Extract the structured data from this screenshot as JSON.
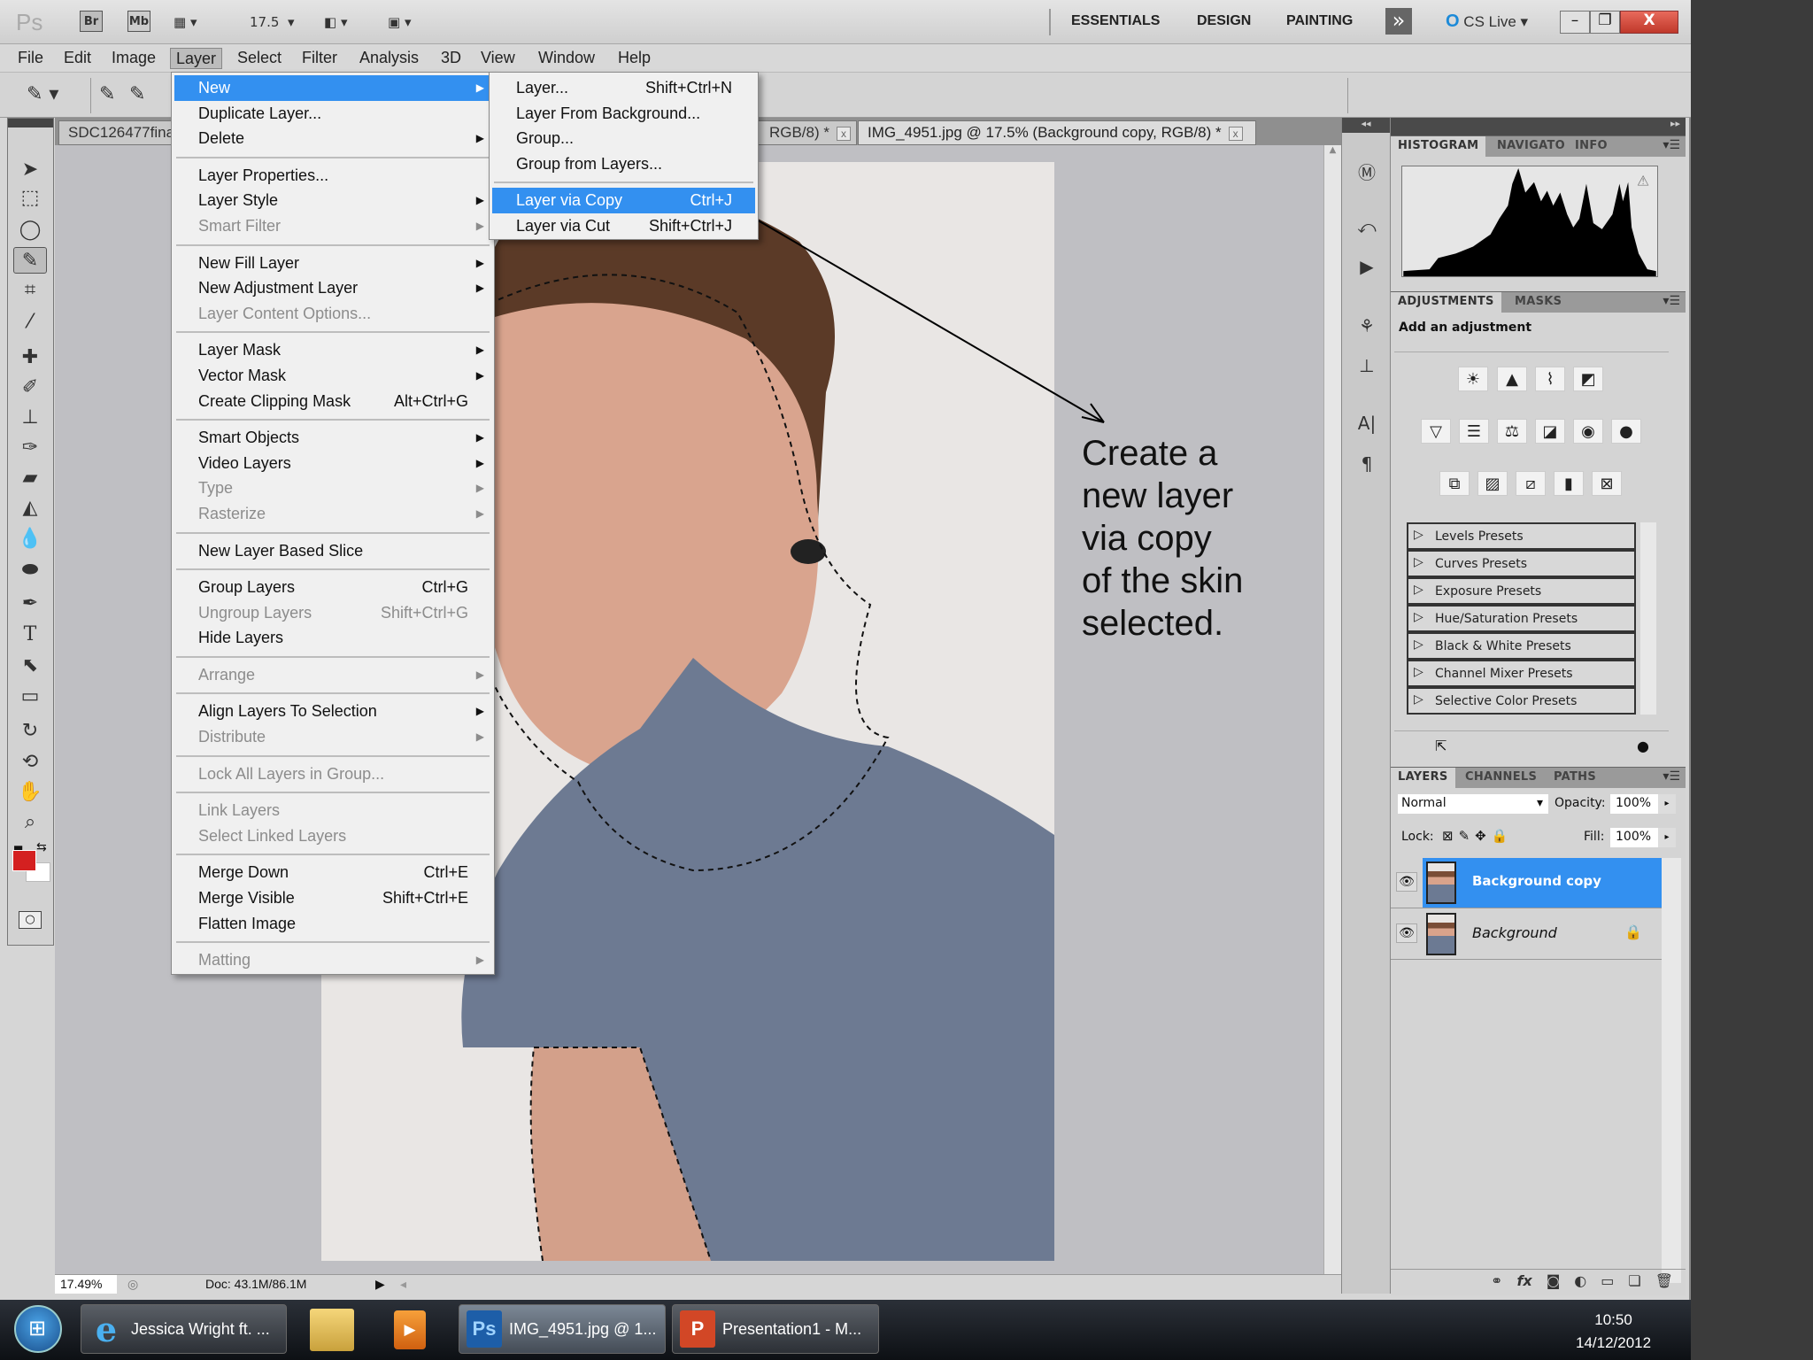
{
  "topbar": {
    "ps_logo": "Ps",
    "bridge": "Br",
    "mini_bridge": "Mb",
    "zoom_level": "17.5",
    "workspaces": [
      "ESSENTIALS",
      "DESIGN",
      "PAINTING"
    ],
    "more": "»",
    "cs_live": "CS Live",
    "window_buttons": {
      "minimize": "–",
      "restore": "❐",
      "close": "X"
    }
  },
  "menubar": [
    "File",
    "Edit",
    "Image",
    "Layer",
    "Select",
    "Filter",
    "Analysis",
    "3D",
    "View",
    "Window",
    "Help"
  ],
  "doc_tabs": [
    {
      "label": "SDC126477fina"
    },
    {
      "label": "RGB/8) *"
    },
    {
      "label": "IMG_4951.jpg @ 17.5% (Background copy, RGB/8) *"
    }
  ],
  "layer_menu": [
    {
      "label": "New",
      "arrow": true,
      "highlight": true
    },
    {
      "label": "Duplicate Layer..."
    },
    {
      "label": "Delete",
      "arrow": true
    },
    {
      "sep": true
    },
    {
      "label": "Layer Properties..."
    },
    {
      "label": "Layer Style",
      "arrow": true
    },
    {
      "label": "Smart Filter",
      "arrow": true,
      "disabled": true
    },
    {
      "sep": true
    },
    {
      "label": "New Fill Layer",
      "arrow": true
    },
    {
      "label": "New Adjustment Layer",
      "arrow": true
    },
    {
      "label": "Layer Content Options...",
      "disabled": true
    },
    {
      "sep": true
    },
    {
      "label": "Layer Mask",
      "arrow": true
    },
    {
      "label": "Vector Mask",
      "arrow": true
    },
    {
      "label": "Create Clipping Mask",
      "shortcut": "Alt+Ctrl+G"
    },
    {
      "sep": true
    },
    {
      "label": "Smart Objects",
      "arrow": true
    },
    {
      "label": "Video Layers",
      "arrow": true
    },
    {
      "label": "Type",
      "arrow": true,
      "disabled": true
    },
    {
      "label": "Rasterize",
      "arrow": true,
      "disabled": true
    },
    {
      "sep": true
    },
    {
      "label": "New Layer Based Slice"
    },
    {
      "sep": true
    },
    {
      "label": "Group Layers",
      "shortcut": "Ctrl+G"
    },
    {
      "label": "Ungroup Layers",
      "shortcut": "Shift+Ctrl+G",
      "disabled": true
    },
    {
      "label": "Hide Layers"
    },
    {
      "sep": true
    },
    {
      "label": "Arrange",
      "arrow": true,
      "disabled": true
    },
    {
      "sep": true
    },
    {
      "label": "Align Layers To Selection",
      "arrow": true
    },
    {
      "label": "Distribute",
      "arrow": true,
      "disabled": true
    },
    {
      "sep": true
    },
    {
      "label": "Lock All Layers in Group...",
      "disabled": true
    },
    {
      "sep": true
    },
    {
      "label": "Link Layers",
      "disabled": true
    },
    {
      "label": "Select Linked Layers",
      "disabled": true
    },
    {
      "sep": true
    },
    {
      "label": "Merge Down",
      "shortcut": "Ctrl+E"
    },
    {
      "label": "Merge Visible",
      "shortcut": "Shift+Ctrl+E"
    },
    {
      "label": "Flatten Image"
    },
    {
      "sep": true
    },
    {
      "label": "Matting",
      "arrow": true,
      "disabled": true
    }
  ],
  "new_submenu": [
    {
      "label": "Layer...",
      "shortcut": "Shift+Ctrl+N"
    },
    {
      "label": "Layer From Background..."
    },
    {
      "label": "Group..."
    },
    {
      "label": "Group from Layers..."
    },
    {
      "sep": true
    },
    {
      "label": "Layer via Copy",
      "shortcut": "Ctrl+J",
      "highlight": true
    },
    {
      "label": "Layer via Cut",
      "shortcut": "Shift+Ctrl+J"
    }
  ],
  "annotation": "Create a\nnew layer\nvia copy\nof the skin\nselected.",
  "status": {
    "zoom": "17.49%",
    "doc": "Doc: 43.1M/86.1M"
  },
  "panels": {
    "histogram_tabs": [
      "HISTOGRAM",
      "NAVIGATO",
      "INFO"
    ],
    "adjustments_tabs": [
      "ADJUSTMENTS",
      "MASKS"
    ],
    "add_adjustment": "Add an adjustment",
    "presets": [
      "Levels Presets",
      "Curves Presets",
      "Exposure Presets",
      "Hue/Saturation Presets",
      "Black & White Presets",
      "Channel Mixer Presets",
      "Selective Color Presets"
    ],
    "layers_tabs": [
      "LAYERS",
      "CHANNELS",
      "PATHS"
    ],
    "blend_mode": "Normal",
    "opacity_label": "Opacity:",
    "opacity": "100%",
    "lock_label": "Lock:",
    "fill_label": "Fill:",
    "fill": "100%",
    "layers": [
      {
        "name": "Background copy",
        "selected": true
      },
      {
        "name": "Background",
        "locked": true
      }
    ]
  },
  "taskbar": {
    "items": [
      {
        "label": "Jessica Wright ft. ..."
      },
      {
        "label": "IMG_4951.jpg @ 1..."
      },
      {
        "label": "Presentation1 - M..."
      }
    ],
    "time": "10:50",
    "date": "14/12/2012"
  },
  "colors": {
    "accent": "#3390f0",
    "foreground": "#d42020",
    "background": "#ffffff"
  }
}
